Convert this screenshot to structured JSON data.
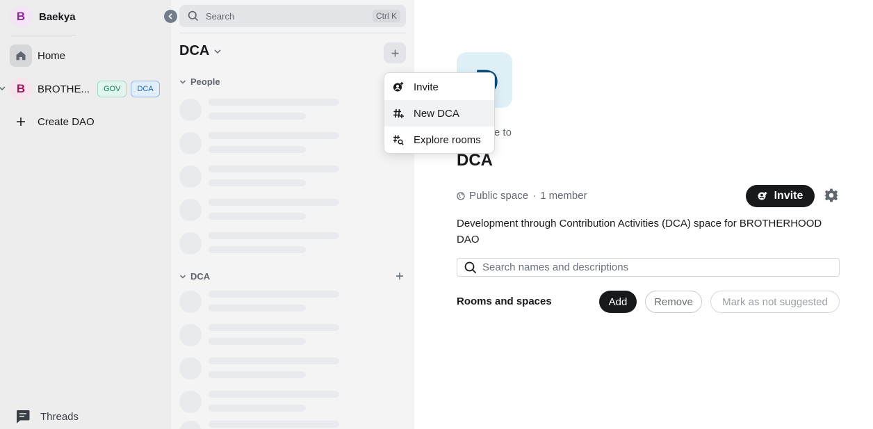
{
  "user": {
    "avatar_letter": "B",
    "name": "Baekya"
  },
  "space_nav": {
    "home_label": "Home",
    "dao": {
      "avatar_letter": "B",
      "name": "BROTHERHOOD DAO",
      "display_name": "BROTHE...",
      "tags": [
        "GOV",
        "DCA"
      ]
    },
    "create_label": "Create DAO",
    "threads_label": "Threads"
  },
  "room_list": {
    "search_placeholder": "Search",
    "search_shortcut": "Ctrl K",
    "space_title": "DCA",
    "sections": [
      {
        "label": "People"
      },
      {
        "label": "DCA"
      }
    ]
  },
  "context_menu": {
    "items": [
      {
        "label": "Invite",
        "icon": "invite-icon"
      },
      {
        "label": "New DCA",
        "icon": "hash-plus-icon"
      },
      {
        "label": "Explore rooms",
        "icon": "explore-rooms-icon"
      }
    ]
  },
  "space_home": {
    "avatar_letter": "D",
    "welcome": "Welcome to",
    "title": "DCA",
    "visibility": "Public space",
    "separator": "·",
    "members": "1 member",
    "invite_label": "Invite",
    "description": "Development through Contribution Activities (DCA) space for BROTHERHOOD DAO",
    "search_placeholder": "Search names and descriptions",
    "rooms_label": "Rooms and spaces",
    "add_label": "Add",
    "remove_label": "Remove",
    "mark_label": "Mark as not suggested"
  },
  "colors": {
    "accent_dark": "#17191c",
    "gov_tag": "#0d7a55",
    "dca_tag": "#1f63b0",
    "user_avatar": "#8e2a95",
    "dao_avatar": "#a3195b"
  }
}
